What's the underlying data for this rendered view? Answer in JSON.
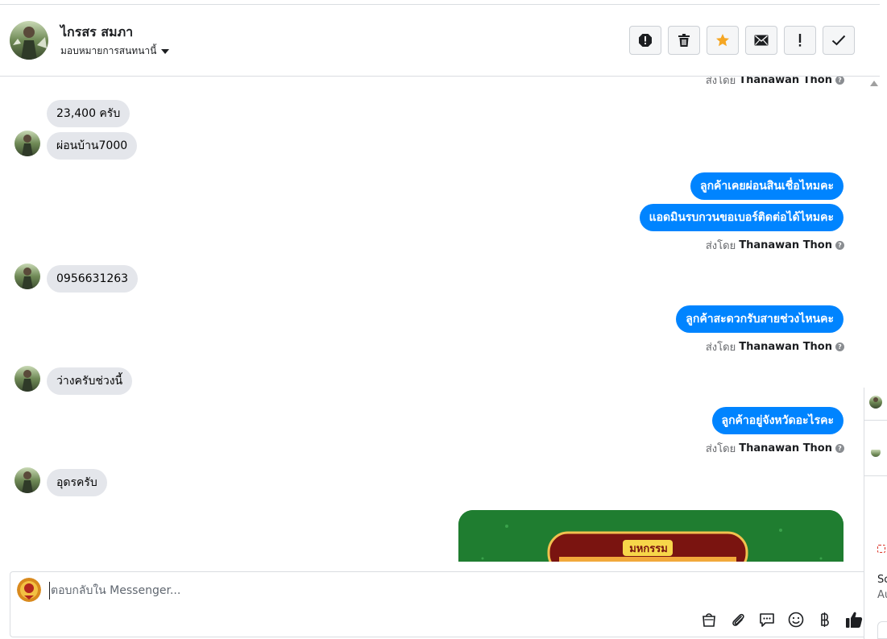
{
  "header": {
    "name": "ไกรสร สมภา",
    "assign_label": "มอบหมายการสนทนานี้",
    "actions": [
      {
        "name": "report-icon"
      },
      {
        "name": "trash-icon"
      },
      {
        "name": "star-icon"
      },
      {
        "name": "envelope-icon"
      },
      {
        "name": "important-icon"
      },
      {
        "name": "check-icon"
      }
    ]
  },
  "messages": {
    "sent_prefix": "ส่งโดย",
    "agent_name": "Thanawan Thon",
    "m1": "23,400 ครับ",
    "m2": "ผ่อนบ้าน7000",
    "m3": "ลูกค้าเคยผ่อนสินเชื่อไหมคะ",
    "m4": "แอดมินรบกวนขอเบอร์ติดต่อได้ไหมคะ",
    "m5": "0956631263",
    "m6": "ลูกค้าสะดวกรับสายช่วงไหนคะ",
    "m7": "ว่างครับช่วงนี้",
    "m8": "ลูกค้าอยู่จังหวัดอะไรคะ",
    "m9": "อุดรครับ",
    "image_banner_text": "มหกรรม"
  },
  "composer": {
    "placeholder": "ตอบกลับใน Messenger...",
    "tools": [
      "bag-icon",
      "attach-icon",
      "saved-reply-icon",
      "emoji-icon",
      "baht-icon",
      "thumbs-up-icon"
    ]
  },
  "side_panel": {
    "text1": "Sc",
    "text2": "Au"
  },
  "colors": {
    "outgoing": "#0084ff",
    "incoming": "#e4e6eb",
    "star": "#f5a623"
  }
}
